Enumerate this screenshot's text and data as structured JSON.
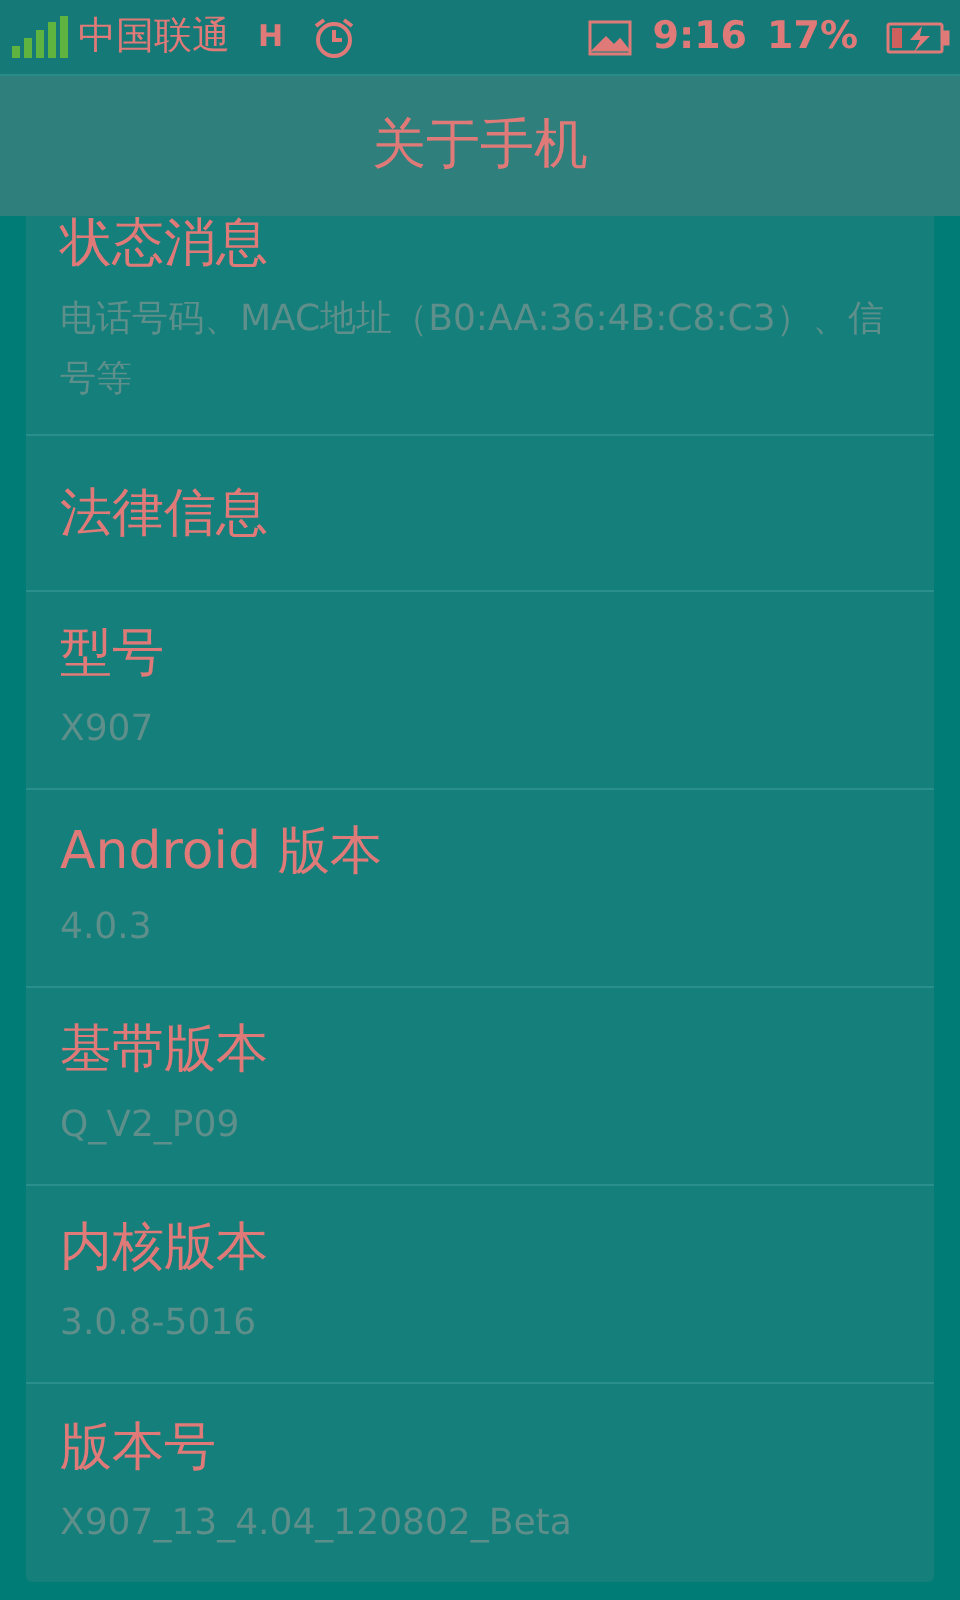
{
  "status_bar": {
    "carrier": "中国联通",
    "network": "H",
    "time": "9:16",
    "battery": "17%"
  },
  "title": "关于手机",
  "items": [
    {
      "title": "状态消息",
      "subtitle": "电话号码、MAC地址（B0:AA:36:4B:C8:C3）、信号等"
    },
    {
      "title": "法律信息"
    },
    {
      "title": "型号",
      "subtitle": "X907"
    },
    {
      "title": "Android 版本",
      "subtitle": "4.0.3"
    },
    {
      "title": "基带版本",
      "subtitle": "Q_V2_P09"
    },
    {
      "title": "内核版本",
      "subtitle": "3.0.8-5016"
    },
    {
      "title": "版本号",
      "subtitle": "X907_13_4.04_120802_Beta"
    }
  ]
}
